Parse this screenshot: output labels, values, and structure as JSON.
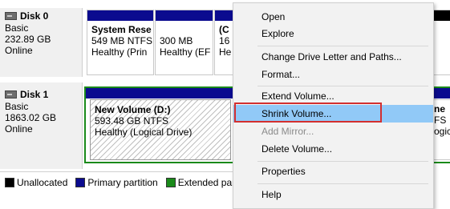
{
  "disks": [
    {
      "name": "Disk 0",
      "type": "Basic",
      "size": "232.89 GB",
      "status": "Online",
      "volumes": [
        {
          "title": "System Rese",
          "line1": "549 MB NTFS",
          "line2": "Healthy (Prin"
        },
        {
          "title": "",
          "line1": "300 MB",
          "line2": "Healthy (EF"
        },
        {
          "title": "(C",
          "line1": "16",
          "line2": "He"
        }
      ]
    },
    {
      "name": "Disk 1",
      "type": "Basic",
      "size": "1863.02 GB",
      "status": "Online",
      "volumes": [
        {
          "title": "New Volume  (D:)",
          "line1": "593.48 GB NTFS",
          "line2": "Healthy (Logical Drive)"
        },
        {
          "title": "ne",
          "line1": "FS",
          "line2": "ogic"
        }
      ]
    }
  ],
  "legend": {
    "items": [
      {
        "label": "Unallocated",
        "color": "#000000"
      },
      {
        "label": "Primary partition",
        "color": "#0b0b8f"
      },
      {
        "label": "Extended part",
        "color": "#1a8a1a"
      }
    ]
  },
  "context_menu": {
    "items": [
      {
        "label": "Open",
        "enabled": true
      },
      {
        "label": "Explore",
        "enabled": true
      },
      {
        "label": "Change Drive Letter and Paths...",
        "enabled": true
      },
      {
        "label": "Format...",
        "enabled": true
      },
      {
        "label": "Extend Volume...",
        "enabled": true
      },
      {
        "label": "Shrink Volume...",
        "enabled": true,
        "highlighted": true
      },
      {
        "label": "Add Mirror...",
        "enabled": false
      },
      {
        "label": "Delete Volume...",
        "enabled": true
      },
      {
        "label": "Properties",
        "enabled": true
      },
      {
        "label": "Help",
        "enabled": true
      }
    ]
  },
  "colors": {
    "primary": "#0b0b8f",
    "extended": "#1a8a1a",
    "highlight": "#91c9f7",
    "callout": "#d32f2f"
  }
}
